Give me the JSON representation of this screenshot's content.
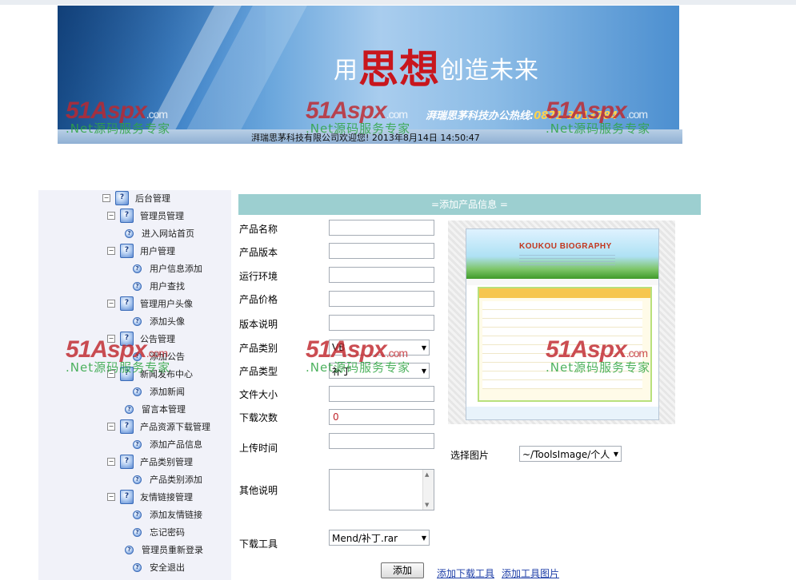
{
  "banner": {
    "slogan_pre": "用",
    "slogan_big": "思想",
    "slogan_post": "创造未来",
    "hotline_label": "湃瑞思茅科技办公热线:",
    "hotline_number": "0871-3013784",
    "status": "湃瑞思茅科技有限公司欢迎您!  2013年8月14日  14:50:47"
  },
  "watermark": {
    "logo": "51Aspx",
    "suffix": ".com",
    "tagline": ".Net源码服务专家"
  },
  "sidebar": {
    "items": [
      {
        "label": "后台管理",
        "level": 0
      },
      {
        "label": "管理员管理",
        "level": 1
      },
      {
        "label": "进入网站首页",
        "level": 2
      },
      {
        "label": "用户管理",
        "level": 1
      },
      {
        "label": "用户信息添加",
        "level": 2
      },
      {
        "label": "用户查找",
        "level": 2
      },
      {
        "label": "管理用户头像",
        "level": 1
      },
      {
        "label": "添加头像",
        "level": 2
      },
      {
        "label": "公告管理",
        "level": 1
      },
      {
        "label": "添加公告",
        "level": 2
      },
      {
        "label": "新闻发布中心",
        "level": 1
      },
      {
        "label": "添加新闻",
        "level": 2
      },
      {
        "label": "留言本管理",
        "level": 2
      },
      {
        "label": "产品资源下载管理",
        "level": 1
      },
      {
        "label": "添加产品信息",
        "level": 2
      },
      {
        "label": "产品类别管理",
        "level": 1
      },
      {
        "label": "产品类别添加",
        "level": 2
      },
      {
        "label": "友情链接管理",
        "level": 1
      },
      {
        "label": "添加友情链接",
        "level": 2
      },
      {
        "label": "忘记密码",
        "level": 2
      },
      {
        "label": "管理员重新登录",
        "level": 2
      },
      {
        "label": "安全退出",
        "level": 2
      }
    ]
  },
  "form": {
    "title": "=添加产品信息 =",
    "labels": {
      "name": "产品名称",
      "version": "产品版本",
      "env": "运行环境",
      "price": "产品价格",
      "version_desc": "版本说明",
      "category": "产品类别",
      "type": "产品类型",
      "size": "文件大小",
      "downloads": "下载次数",
      "upload_time": "上传时间",
      "notes": "其他说明",
      "tool": "下载工具",
      "image": "选择图片"
    },
    "values": {
      "downloads": "0",
      "category": "VB",
      "type": "补丁",
      "tool": "Mend/补丁.rar",
      "image": "~/ToolsImage/个人"
    },
    "buttons": {
      "add": "添加"
    },
    "links": {
      "add_tool": "添加下载工具",
      "add_tool_image": "添加工具图片"
    }
  },
  "preview": {
    "brand": "KOUKOU BIOGRAPHY"
  }
}
